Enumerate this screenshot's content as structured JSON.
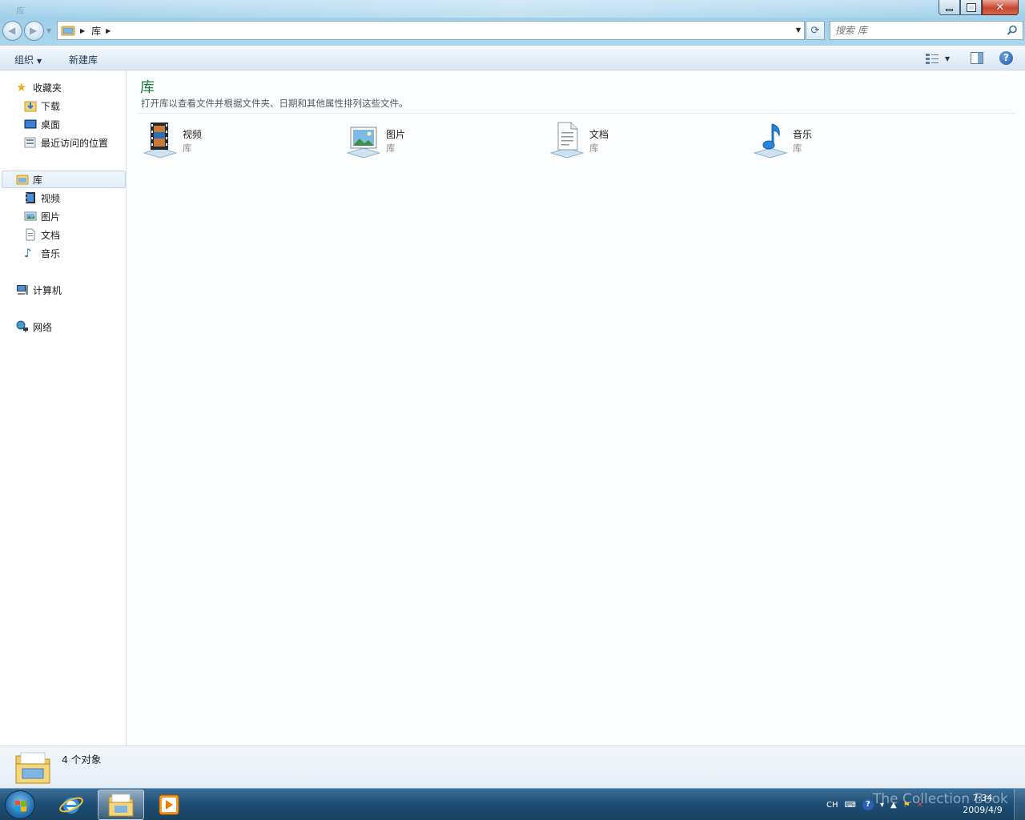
{
  "window": {
    "title": "库",
    "controls": {
      "minimize": "minimize",
      "maximize": "maximize",
      "close": "close"
    }
  },
  "address": {
    "breadcrumb": [
      "库"
    ],
    "search_placeholder": "搜索 库"
  },
  "toolbar": {
    "organize": "组织",
    "new_library": "新建库"
  },
  "nav": {
    "favorites": {
      "label": "收藏夹",
      "items": [
        {
          "label": "下载",
          "icon": "downloads-folder-icon"
        },
        {
          "label": "桌面",
          "icon": "desktop-icon"
        },
        {
          "label": "最近访问的位置",
          "icon": "recent-places-icon"
        }
      ]
    },
    "libraries": {
      "label": "库",
      "items": [
        {
          "label": "视频",
          "icon": "videos-icon"
        },
        {
          "label": "图片",
          "icon": "pictures-icon"
        },
        {
          "label": "文档",
          "icon": "documents-icon"
        },
        {
          "label": "音乐",
          "icon": "music-icon"
        }
      ]
    },
    "computer": {
      "label": "计算机"
    },
    "network": {
      "label": "网络"
    }
  },
  "content": {
    "heading": "库",
    "description": "打开库以查看文件并根据文件夹、日期和其他属性排列这些文件。",
    "items": [
      {
        "name": "视频",
        "type": "库",
        "icon": "videos-library-icon"
      },
      {
        "name": "图片",
        "type": "库",
        "icon": "pictures-library-icon"
      },
      {
        "name": "文档",
        "type": "库",
        "icon": "documents-library-icon"
      },
      {
        "name": "音乐",
        "type": "库",
        "icon": "music-library-icon"
      }
    ]
  },
  "details": {
    "count": "4 个对象"
  },
  "taskbar": {
    "pinned": [
      "internet-explorer-icon",
      "explorer-folder-icon",
      "media-player-icon"
    ],
    "tray": {
      "lang": "CH"
    },
    "clock_time": "7:34",
    "clock_date": "2009/4/9",
    "watermark": "The Collection Book"
  }
}
